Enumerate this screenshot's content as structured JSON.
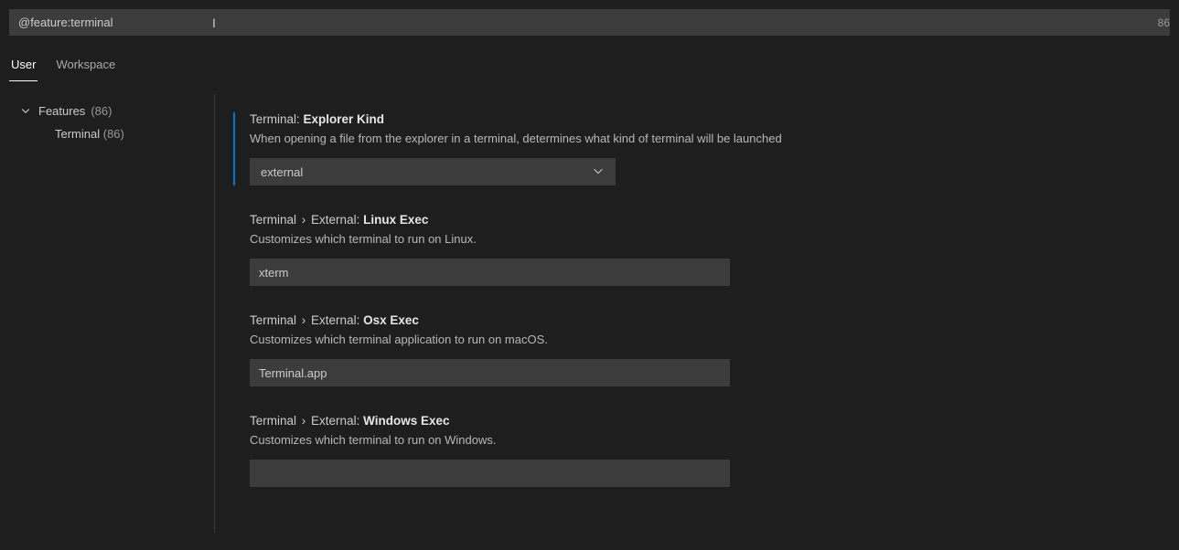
{
  "search": {
    "value": "@feature:terminal",
    "count": "86"
  },
  "tabs": {
    "user": "User",
    "workspace": "Workspace"
  },
  "sidebar": {
    "group": {
      "label": "Features",
      "count": "(86)"
    },
    "sub": {
      "label": "Terminal",
      "count": "(86)"
    }
  },
  "settings": [
    {
      "prefix": "Terminal:",
      "name": "Explorer Kind",
      "desc": "When opening a file from the explorer in a terminal, determines what kind of terminal will be launched",
      "type": "select",
      "value": "external",
      "modified": true
    },
    {
      "prefix": "Terminal",
      "sep": "›",
      "mid": "External:",
      "name": "Linux Exec",
      "desc": "Customizes which terminal to run on Linux.",
      "type": "text",
      "value": "xterm"
    },
    {
      "prefix": "Terminal",
      "sep": "›",
      "mid": "External:",
      "name": "Osx Exec",
      "desc": "Customizes which terminal application to run on macOS.",
      "type": "text",
      "value": "Terminal.app"
    },
    {
      "prefix": "Terminal",
      "sep": "›",
      "mid": "External:",
      "name": "Windows Exec",
      "desc": "Customizes which terminal to run on Windows.",
      "type": "text",
      "value": ""
    }
  ]
}
